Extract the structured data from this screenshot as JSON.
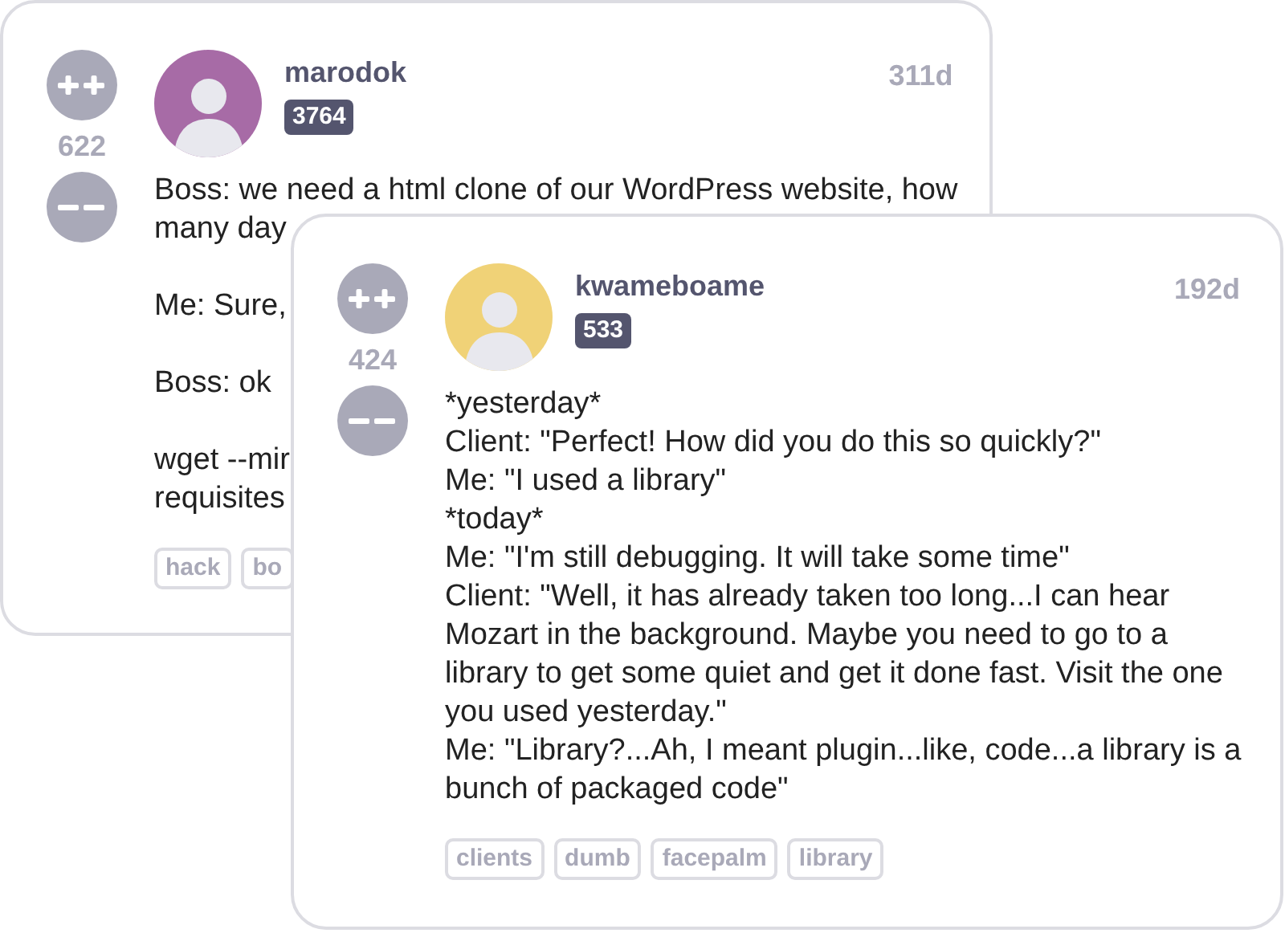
{
  "rants": [
    {
      "score": "622",
      "username": "marodok",
      "user_score": "3764",
      "age": "311d",
      "avatar": {
        "color": "#a76ba6"
      },
      "paragraphs": [
        [
          "Boss: we need a html clone of our WordPress website, how",
          "many day"
        ],
        [
          "Me: Sure,"
        ],
        [
          "Boss: ok"
        ],
        [
          "wget --mir",
          "requisites"
        ]
      ],
      "tags": [
        "hack",
        "bo"
      ]
    },
    {
      "score": "424",
      "username": "kwameboame",
      "user_score": "533",
      "age": "192d",
      "avatar": {
        "color": "#f0d277"
      },
      "paragraphs": [
        [
          "*yesterday*",
          "Client: \"Perfect! How did you do this so quickly?\"",
          "Me: \"I used a library\"",
          "*today*",
          "Me: \"I'm still debugging. It will take some time\"",
          "Client: \"Well, it has already taken too long...I can hear",
          "Mozart in the background. Maybe you need to go to a",
          "library to get some quiet and get it done fast. Visit the one",
          "you used yesterday.\"",
          "Me: \"Library?...Ah, I meant plugin...like, code...a library is a",
          "bunch of packaged code\""
        ]
      ],
      "tags": [
        "clients",
        "dumb",
        "facepalm",
        "library"
      ]
    }
  ]
}
